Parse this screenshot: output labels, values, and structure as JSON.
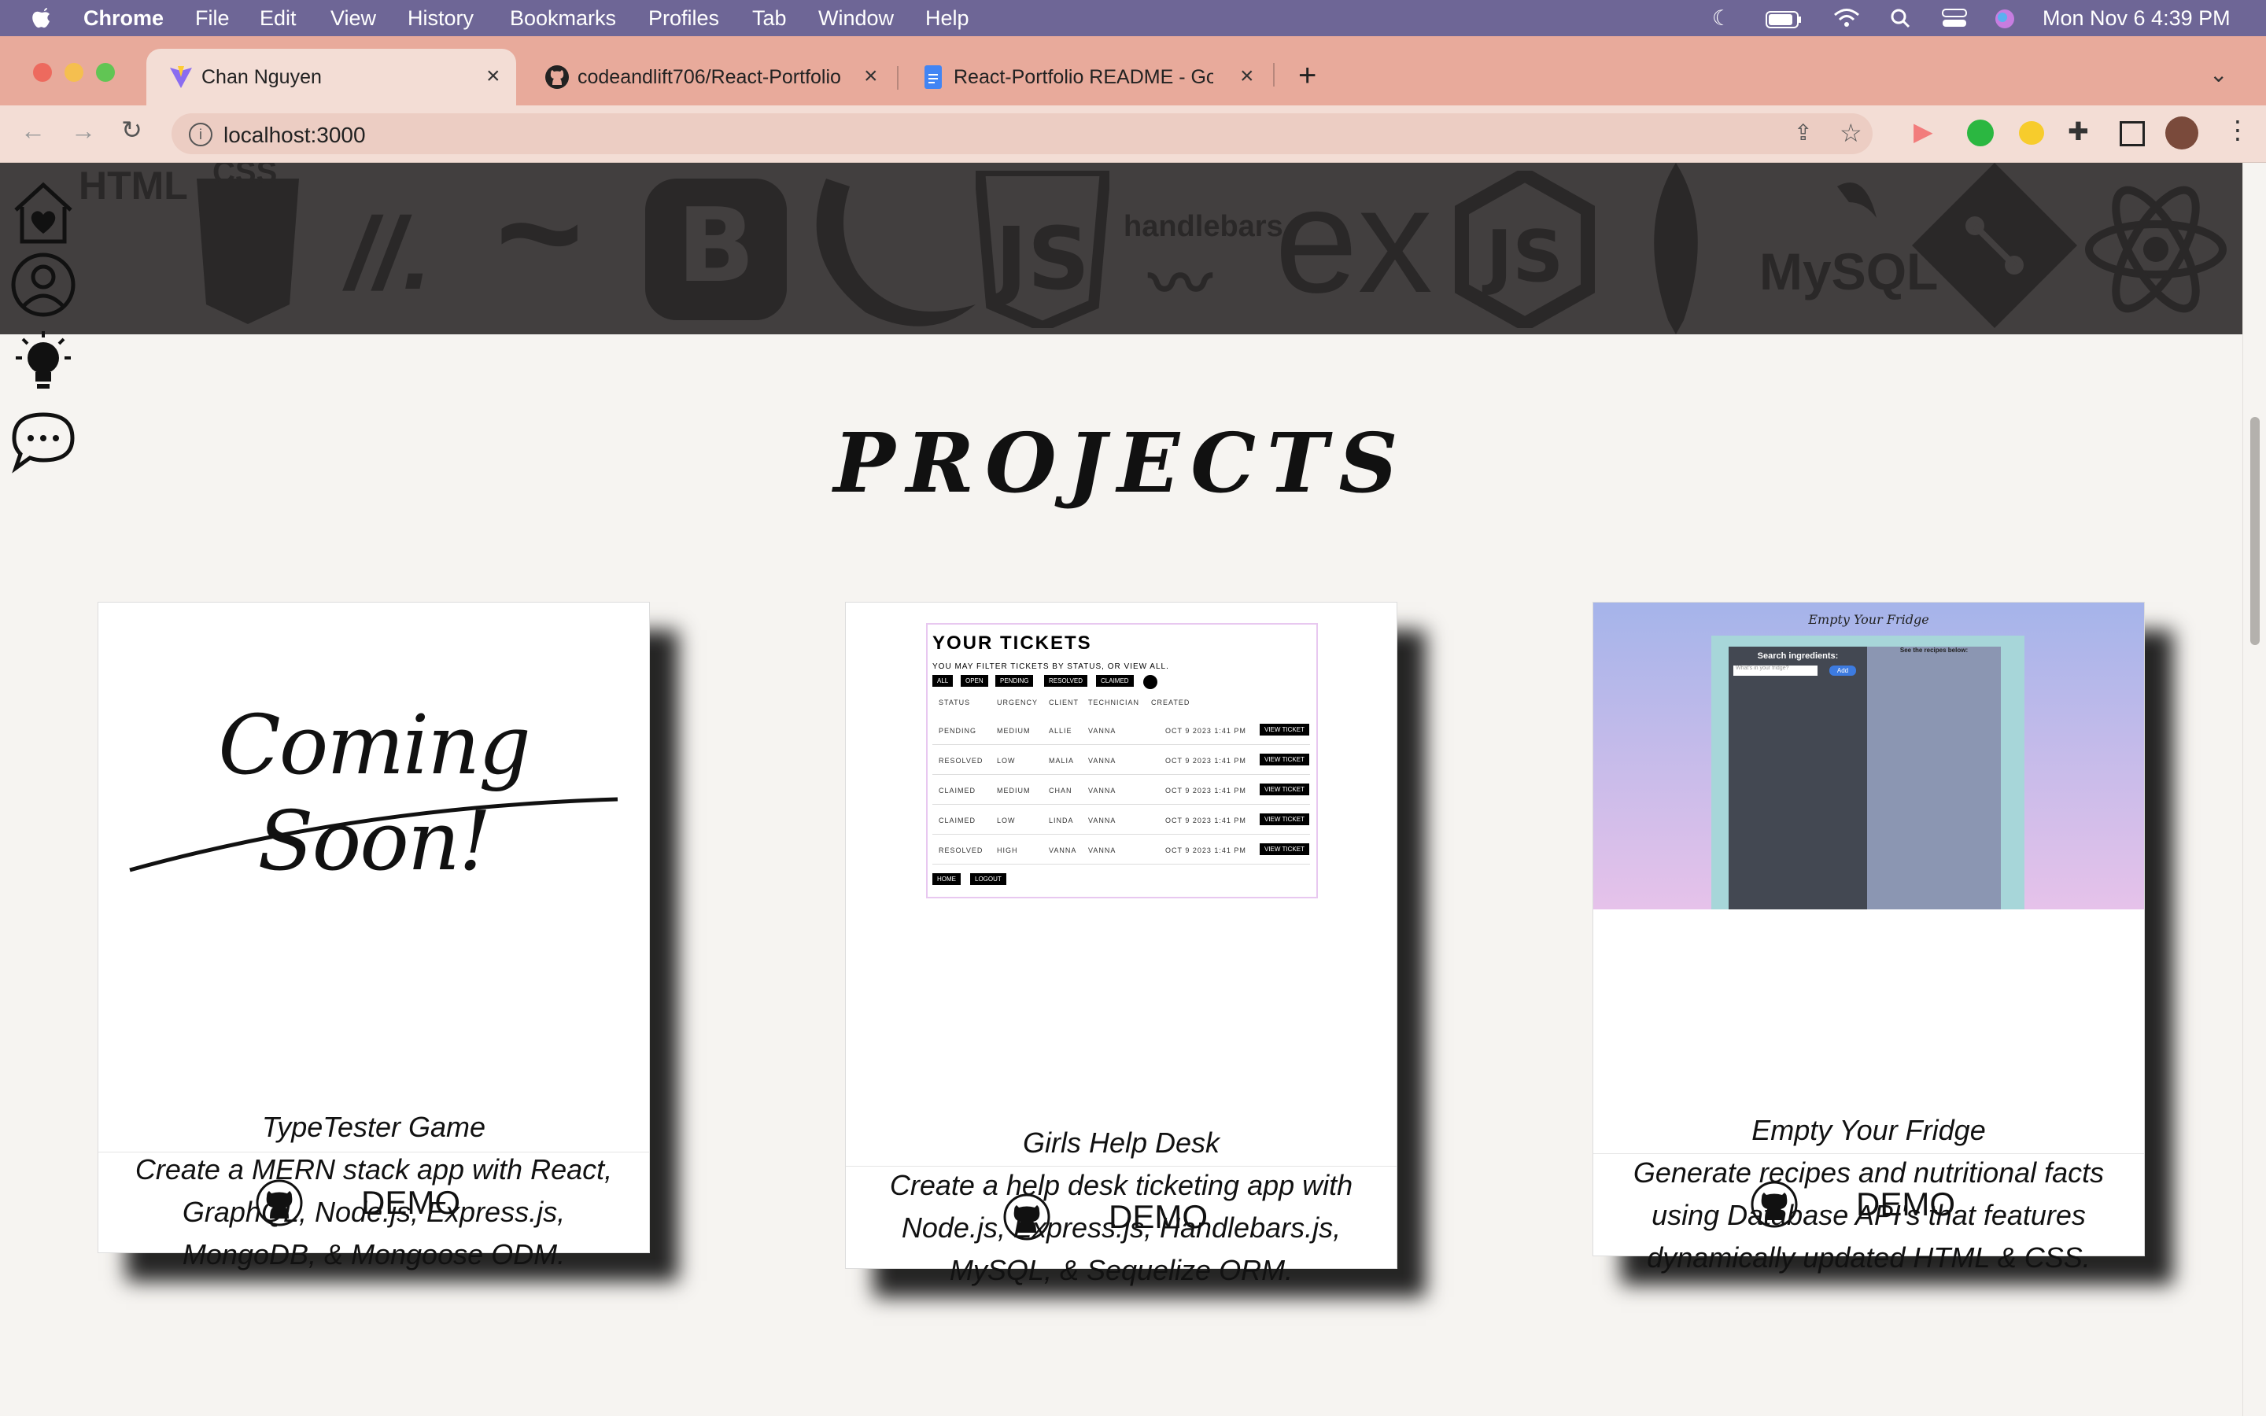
{
  "menubar": {
    "app": "Chrome",
    "items": [
      "File",
      "Edit",
      "View",
      "History",
      "Bookmarks",
      "Profiles",
      "Tab",
      "Window",
      "Help"
    ],
    "datetime": "Mon Nov 6  4:39 PM"
  },
  "tabs": [
    {
      "title": "Chan Nguyen",
      "active": true
    },
    {
      "title": "codeandlift706/React-Portfolio",
      "active": false
    },
    {
      "title": "React-Portfolio README - Goo",
      "active": false
    }
  ],
  "toolbar": {
    "url": "localhost:3000"
  },
  "banner": {
    "techs": [
      "HTML",
      "CSS",
      "//.",
      "~",
      "B",
      "jQ",
      "JS",
      "handlebars",
      "ex",
      "JS",
      "MySQL",
      "⟨⟩",
      "⚛"
    ]
  },
  "nav": [
    "home",
    "about",
    "skills",
    "contact"
  ],
  "projects": {
    "title": "PROJECTS",
    "cards": [
      {
        "thumb_text": "Coming Soon!",
        "name": "TypeTester Game",
        "desc": "Create a MERN stack app with React, GraphQL, Node.js, Express.js, MongoDB, & Mongoose ODM.",
        "demo": "DEMO"
      },
      {
        "thumb": {
          "heading": "YOUR TICKETS",
          "sub": "YOU MAY FILTER TICKETS BY STATUS, OR VIEW ALL.",
          "filters": [
            "ALL",
            "OPEN",
            "PENDING",
            "RESOLVED",
            "CLAIMED"
          ],
          "cols": [
            "STATUS",
            "URGENCY",
            "CLIENT",
            "TECHNICIAN",
            "CREATED"
          ],
          "rows": [
            [
              "PENDING",
              "MEDIUM",
              "ALLIE",
              "VANNA",
              "OCT 9 2023 1:41 PM"
            ],
            [
              "RESOLVED",
              "LOW",
              "MALIA",
              "VANNA",
              "OCT 9 2023 1:41 PM"
            ],
            [
              "CLAIMED",
              "MEDIUM",
              "CHAN",
              "VANNA",
              "OCT 9 2023 1:41 PM"
            ],
            [
              "CLAIMED",
              "LOW",
              "LINDA",
              "VANNA",
              "OCT 9 2023 1:41 PM"
            ],
            [
              "RESOLVED",
              "HIGH",
              "VANNA",
              "VANNA",
              "OCT 9 2023 1:41 PM"
            ]
          ],
          "view_btn": "VIEW TICKET",
          "footer_btns": [
            "HOME",
            "LOGOUT"
          ]
        },
        "name": "Girls Help Desk",
        "desc": "Create a help desk ticketing app with Node.js, Express.js, Handlebars.js, MySQL, & Sequelize ORM.",
        "demo": "DEMO"
      },
      {
        "thumb": {
          "heading": "Empty Your Fridge",
          "search_label": "Search ingredients:",
          "search_placeholder": "What's in your fridge?",
          "add_btn": "Add",
          "recipes_label": "See the recipes below:"
        },
        "name": "Empty Your Fridge",
        "desc": "Generate recipes and nutritional facts using Database API's that features dynamically updated HTML & CSS.",
        "demo": "DEMO"
      }
    ]
  }
}
